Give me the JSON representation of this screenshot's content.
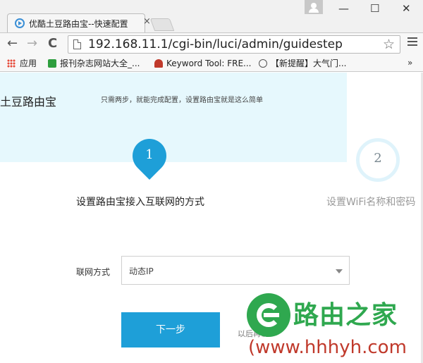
{
  "browser": {
    "tab_title": "优酷土豆路由宝--快速配置",
    "tab_close": "×",
    "window_minimize": "—",
    "window_maximize": "☐",
    "window_close": "✕",
    "back": "←",
    "forward": "→",
    "reload": "C",
    "url": "192.168.11.1/cgi-bin/luci/admin/guidestep",
    "bookmark_star": "☆",
    "bookmarks": [
      {
        "label": "应用"
      },
      {
        "label": "报刊杂志网站大全_..."
      },
      {
        "label": "Keyword Tool: FRE..."
      },
      {
        "label": "【新提醒】大气门..."
      }
    ],
    "bookmarks_more": "»"
  },
  "page": {
    "brand": "土豆路由宝",
    "tagline": "只需两步，就能完成配置，设置路由宝就是这么简单",
    "steps": [
      {
        "number": "1",
        "label": "设置路由宝接入互联网的方式"
      },
      {
        "number": "2",
        "label": "设置WiFi名称和密码"
      }
    ],
    "form": {
      "connection_label": "联网方式",
      "connection_value": "动态IP"
    },
    "next_button": "下一步",
    "later_link": "以后再说"
  },
  "watermark": {
    "title": "路由之家",
    "url": "(www.hhhyh.com"
  },
  "colors": {
    "accent": "#1e9fd8",
    "hero_bg": "#e6f8fd",
    "watermark_green": "#2fa84f",
    "watermark_red": "#c0392b"
  }
}
